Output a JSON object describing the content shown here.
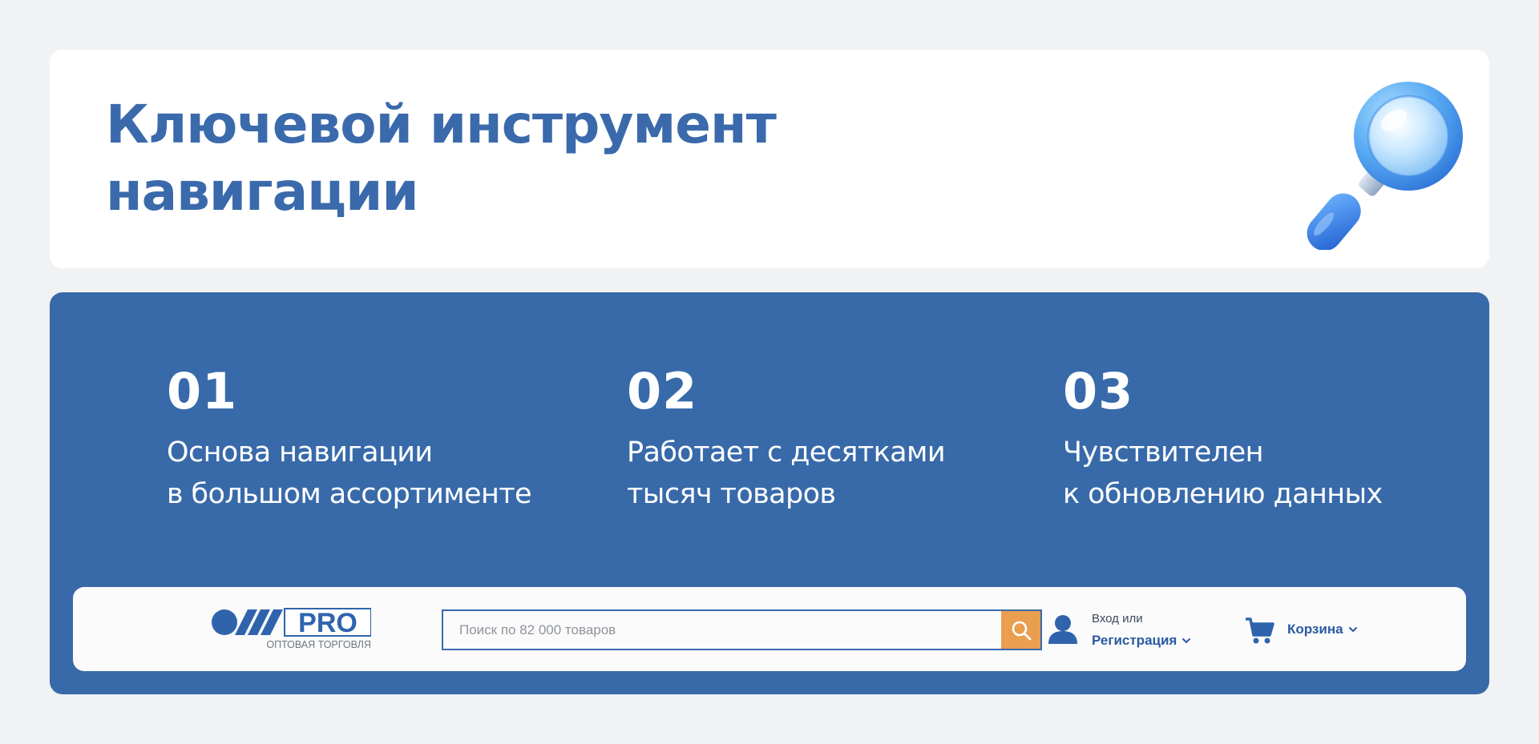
{
  "hero": {
    "title_line1": "Ключевой инструмент",
    "title_line2": "навигации",
    "icon": "magnifier-icon"
  },
  "features": [
    {
      "number": "01",
      "line1": "Основа навигации",
      "line2": "в большом ассортименте"
    },
    {
      "number": "02",
      "line1": "Работает с десятками",
      "line2": "тысяч товаров"
    },
    {
      "number": "03",
      "line1": "Чувствителен",
      "line2": "к обновлению данных"
    }
  ],
  "site_header": {
    "logo_main": "PRO",
    "logo_sub": "ОПТОВАЯ ТОРГОВЛЯ",
    "search_placeholder": "Поиск по 82 000 товаров",
    "search_value": "",
    "login_small": "Вход или",
    "login_link": "Регистрация",
    "cart_label": "Корзина"
  },
  "colors": {
    "background": "#f0f2f4",
    "brand_blue": "#386aaa",
    "title_blue": "#3a6aab",
    "search_button": "#e99f4f"
  }
}
